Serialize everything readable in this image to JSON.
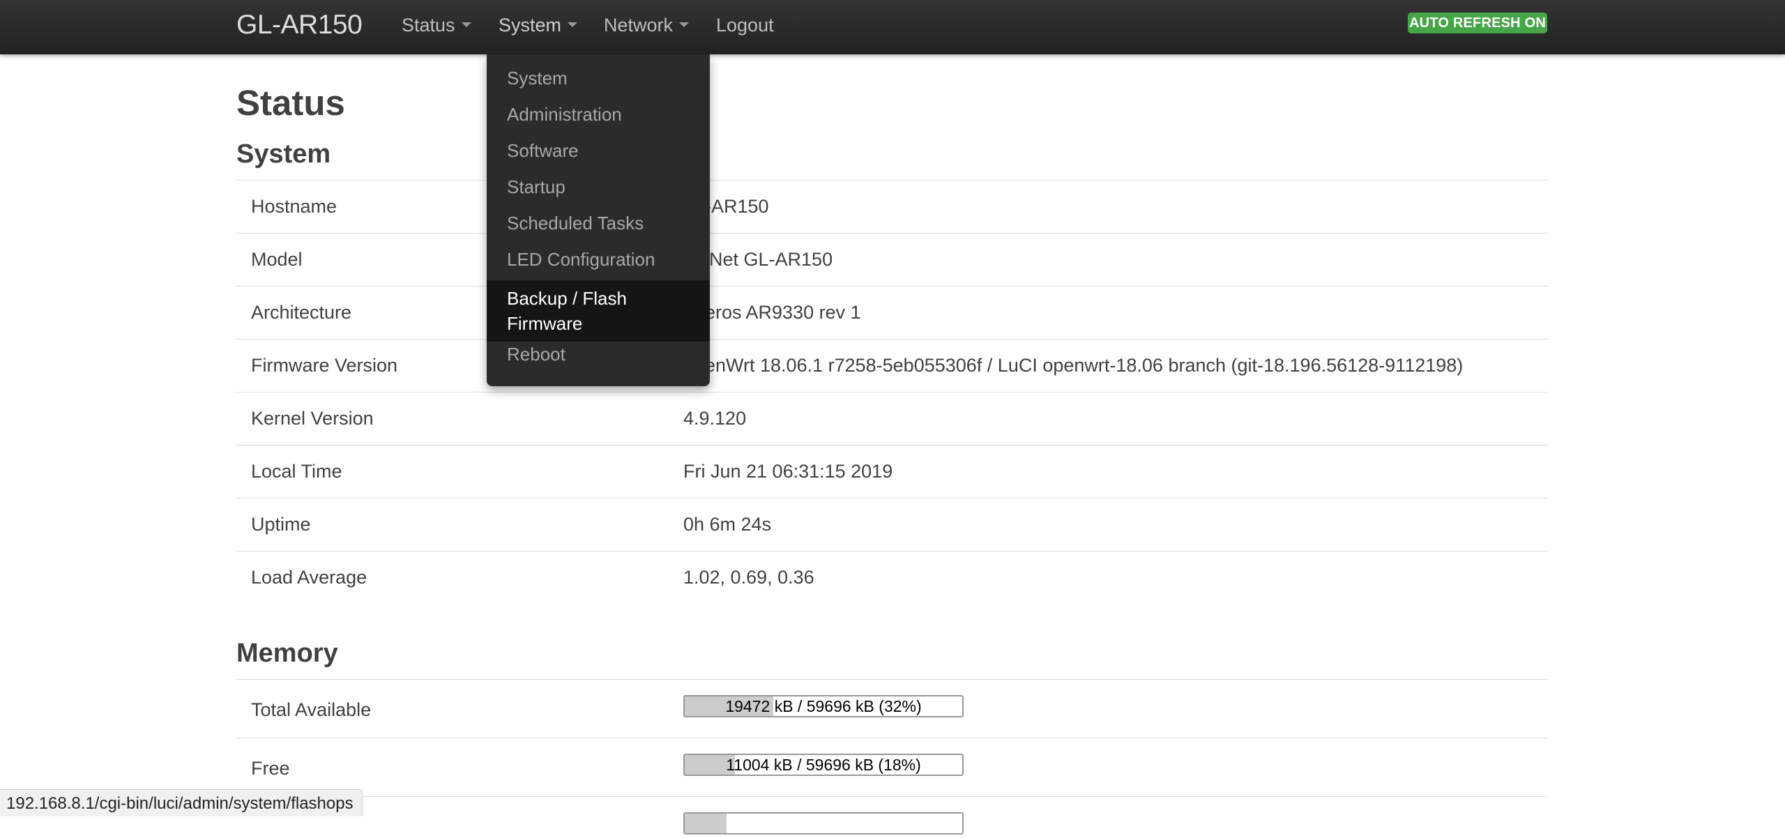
{
  "navbar": {
    "brand": "GL-AR150",
    "items": [
      {
        "label": "Status",
        "has_caret": true
      },
      {
        "label": "System",
        "has_caret": true
      },
      {
        "label": "Network",
        "has_caret": true
      },
      {
        "label": "Logout",
        "has_caret": false
      }
    ],
    "auto_refresh_label": "AUTO REFRESH ON"
  },
  "dropdown": {
    "items": [
      "System",
      "Administration",
      "Software",
      "Startup",
      "Scheduled Tasks",
      "LED Configuration",
      "Backup / Flash Firmware",
      "Reboot"
    ],
    "active_item": "Backup / Flash Firmware"
  },
  "page": {
    "title": "Status"
  },
  "system": {
    "title": "System",
    "rows": [
      {
        "label": "Hostname",
        "value": "-AR150"
      },
      {
        "label": "Model",
        "value": "iNet GL-AR150"
      },
      {
        "label": "Architecture",
        "value": "eros AR9330 rev 1"
      },
      {
        "label": "Firmware Version",
        "value": "enWrt 18.06.1 r7258-5eb055306f / LuCI openwrt-18.06 branch (git-18.196.56128-9112198)"
      },
      {
        "label": "Kernel Version",
        "value": "4.9.120"
      },
      {
        "label": "Local Time",
        "value": "Fri Jun 21 06:31:15 2019"
      },
      {
        "label": "Uptime",
        "value": "0h 6m 24s"
      },
      {
        "label": "Load Average",
        "value": "1.02, 0.69, 0.36"
      }
    ]
  },
  "memory": {
    "title": "Memory",
    "rows": [
      {
        "label": "Total Available",
        "text": "19472 kB / 59696 kB (32%)",
        "percent": 32
      },
      {
        "label": "Free",
        "text": "11004 kB / 59696 kB (18%)",
        "percent": 18
      },
      {
        "label": "",
        "text": "",
        "percent": 15
      }
    ]
  },
  "statusbar": {
    "url": "192.168.8.1/cgi-bin/luci/admin/system/flashops"
  }
}
